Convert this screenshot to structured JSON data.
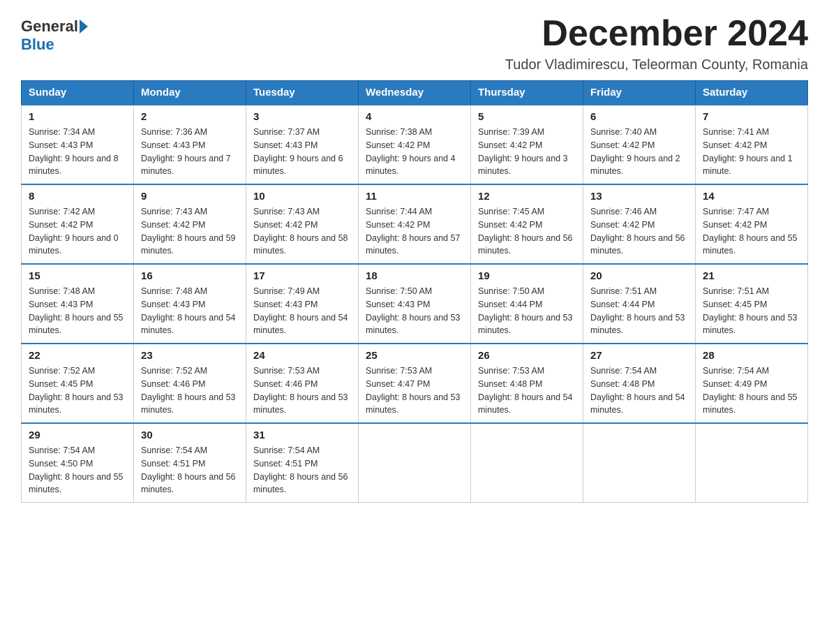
{
  "header": {
    "logo_general": "General",
    "logo_blue": "Blue",
    "month_title": "December 2024",
    "location": "Tudor Vladimirescu, Teleorman County, Romania"
  },
  "days_of_week": [
    "Sunday",
    "Monday",
    "Tuesday",
    "Wednesday",
    "Thursday",
    "Friday",
    "Saturday"
  ],
  "weeks": [
    [
      {
        "day": "1",
        "sunrise": "7:34 AM",
        "sunset": "4:43 PM",
        "daylight": "9 hours and 8 minutes."
      },
      {
        "day": "2",
        "sunrise": "7:36 AM",
        "sunset": "4:43 PM",
        "daylight": "9 hours and 7 minutes."
      },
      {
        "day": "3",
        "sunrise": "7:37 AM",
        "sunset": "4:43 PM",
        "daylight": "9 hours and 6 minutes."
      },
      {
        "day": "4",
        "sunrise": "7:38 AM",
        "sunset": "4:42 PM",
        "daylight": "9 hours and 4 minutes."
      },
      {
        "day": "5",
        "sunrise": "7:39 AM",
        "sunset": "4:42 PM",
        "daylight": "9 hours and 3 minutes."
      },
      {
        "day": "6",
        "sunrise": "7:40 AM",
        "sunset": "4:42 PM",
        "daylight": "9 hours and 2 minutes."
      },
      {
        "day": "7",
        "sunrise": "7:41 AM",
        "sunset": "4:42 PM",
        "daylight": "9 hours and 1 minute."
      }
    ],
    [
      {
        "day": "8",
        "sunrise": "7:42 AM",
        "sunset": "4:42 PM",
        "daylight": "9 hours and 0 minutes."
      },
      {
        "day": "9",
        "sunrise": "7:43 AM",
        "sunset": "4:42 PM",
        "daylight": "8 hours and 59 minutes."
      },
      {
        "day": "10",
        "sunrise": "7:43 AM",
        "sunset": "4:42 PM",
        "daylight": "8 hours and 58 minutes."
      },
      {
        "day": "11",
        "sunrise": "7:44 AM",
        "sunset": "4:42 PM",
        "daylight": "8 hours and 57 minutes."
      },
      {
        "day": "12",
        "sunrise": "7:45 AM",
        "sunset": "4:42 PM",
        "daylight": "8 hours and 56 minutes."
      },
      {
        "day": "13",
        "sunrise": "7:46 AM",
        "sunset": "4:42 PM",
        "daylight": "8 hours and 56 minutes."
      },
      {
        "day": "14",
        "sunrise": "7:47 AM",
        "sunset": "4:42 PM",
        "daylight": "8 hours and 55 minutes."
      }
    ],
    [
      {
        "day": "15",
        "sunrise": "7:48 AM",
        "sunset": "4:43 PM",
        "daylight": "8 hours and 55 minutes."
      },
      {
        "day": "16",
        "sunrise": "7:48 AM",
        "sunset": "4:43 PM",
        "daylight": "8 hours and 54 minutes."
      },
      {
        "day": "17",
        "sunrise": "7:49 AM",
        "sunset": "4:43 PM",
        "daylight": "8 hours and 54 minutes."
      },
      {
        "day": "18",
        "sunrise": "7:50 AM",
        "sunset": "4:43 PM",
        "daylight": "8 hours and 53 minutes."
      },
      {
        "day": "19",
        "sunrise": "7:50 AM",
        "sunset": "4:44 PM",
        "daylight": "8 hours and 53 minutes."
      },
      {
        "day": "20",
        "sunrise": "7:51 AM",
        "sunset": "4:44 PM",
        "daylight": "8 hours and 53 minutes."
      },
      {
        "day": "21",
        "sunrise": "7:51 AM",
        "sunset": "4:45 PM",
        "daylight": "8 hours and 53 minutes."
      }
    ],
    [
      {
        "day": "22",
        "sunrise": "7:52 AM",
        "sunset": "4:45 PM",
        "daylight": "8 hours and 53 minutes."
      },
      {
        "day": "23",
        "sunrise": "7:52 AM",
        "sunset": "4:46 PM",
        "daylight": "8 hours and 53 minutes."
      },
      {
        "day": "24",
        "sunrise": "7:53 AM",
        "sunset": "4:46 PM",
        "daylight": "8 hours and 53 minutes."
      },
      {
        "day": "25",
        "sunrise": "7:53 AM",
        "sunset": "4:47 PM",
        "daylight": "8 hours and 53 minutes."
      },
      {
        "day": "26",
        "sunrise": "7:53 AM",
        "sunset": "4:48 PM",
        "daylight": "8 hours and 54 minutes."
      },
      {
        "day": "27",
        "sunrise": "7:54 AM",
        "sunset": "4:48 PM",
        "daylight": "8 hours and 54 minutes."
      },
      {
        "day": "28",
        "sunrise": "7:54 AM",
        "sunset": "4:49 PM",
        "daylight": "8 hours and 55 minutes."
      }
    ],
    [
      {
        "day": "29",
        "sunrise": "7:54 AM",
        "sunset": "4:50 PM",
        "daylight": "8 hours and 55 minutes."
      },
      {
        "day": "30",
        "sunrise": "7:54 AM",
        "sunset": "4:51 PM",
        "daylight": "8 hours and 56 minutes."
      },
      {
        "day": "31",
        "sunrise": "7:54 AM",
        "sunset": "4:51 PM",
        "daylight": "8 hours and 56 minutes."
      },
      null,
      null,
      null,
      null
    ]
  ]
}
